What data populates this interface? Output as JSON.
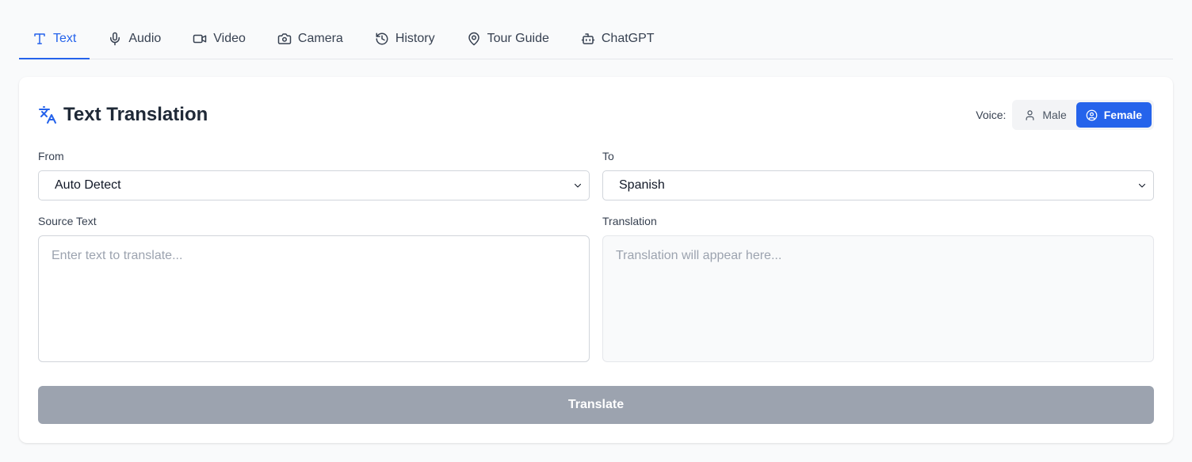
{
  "tabs": [
    {
      "label": "Text",
      "icon": "type-icon",
      "active": true
    },
    {
      "label": "Audio",
      "icon": "mic-icon"
    },
    {
      "label": "Video",
      "icon": "video-icon"
    },
    {
      "label": "Camera",
      "icon": "camera-icon"
    },
    {
      "label": "History",
      "icon": "history-icon"
    },
    {
      "label": "Tour Guide",
      "icon": "map-pin-icon"
    },
    {
      "label": "ChatGPT",
      "icon": "bot-icon"
    }
  ],
  "panel": {
    "title": "Text Translation",
    "title_icon": "languages-icon",
    "voice": {
      "label": "Voice:",
      "options": [
        {
          "label": "Male",
          "icon": "user-icon"
        },
        {
          "label": "Female",
          "icon": "user-circle-icon",
          "selected": true
        }
      ]
    },
    "from": {
      "label": "From",
      "value": "Auto Detect"
    },
    "to": {
      "label": "To",
      "value": "Spanish"
    },
    "source": {
      "label": "Source Text",
      "placeholder": "Enter text to translate..."
    },
    "translation": {
      "label": "Translation",
      "placeholder": "Translation will appear here..."
    },
    "translate_button": "Translate"
  },
  "colors": {
    "accent": "#2563eb",
    "disabled_button": "#9ca3af",
    "border": "#d1d5db"
  }
}
